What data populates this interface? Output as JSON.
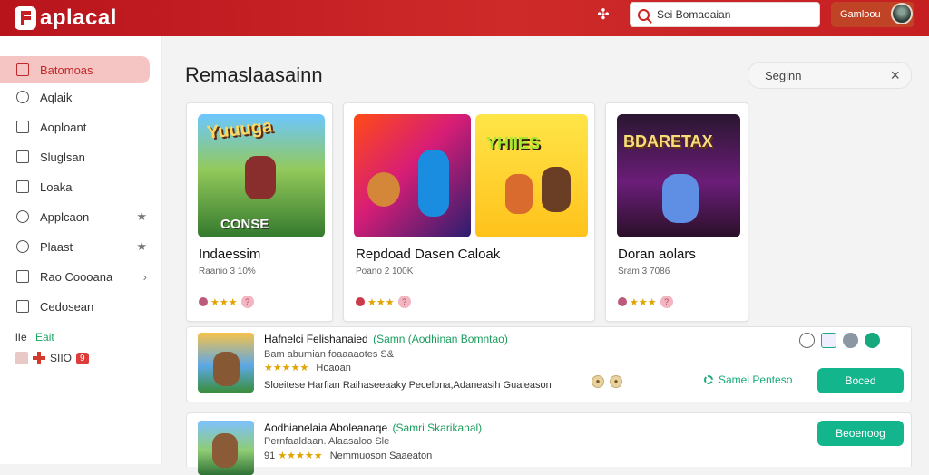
{
  "header": {
    "app_name": "aplacal",
    "search_placeholder": "Sei Bomaoaian",
    "user_label": "Gamloou"
  },
  "sidebar": {
    "items": [
      {
        "label": "Batomoas",
        "active": true
      },
      {
        "label": "Aqlaik"
      },
      {
        "label": "Aoploant"
      },
      {
        "label": "Sluglsan"
      },
      {
        "label": "Loaka"
      },
      {
        "label": "Applcaon",
        "right_icon": "★"
      },
      {
        "label": "Plaast",
        "right_icon": "★"
      },
      {
        "label": "Rao Coooana",
        "right_icon": "›"
      },
      {
        "label": "Cedosean"
      }
    ],
    "footer_a_left": "lIe",
    "footer_a_right": "Eait",
    "footer_b_text": "SIIO",
    "footer_b_badge": "9"
  },
  "main": {
    "title": "Remaslaasainn",
    "search_placeholder": "Seginn",
    "featured": [
      {
        "title": "Indaessim",
        "subtitle": "Raanio 3 10%",
        "image_text": "Yuuuga",
        "image_caption": "CONSE"
      },
      {
        "title": "Repdoad Dasen Caloak",
        "subtitle": "Poano 2 100K",
        "image_text": "YHIIES"
      },
      {
        "title": "Doran aolars",
        "subtitle": "Sram 3 7086",
        "image_text": "BDARETAX"
      }
    ],
    "list": [
      {
        "title": "Hafnelci Felishanaied",
        "tag": "(Samn (Aodhinan Bomntao)",
        "meta1": "Bam abumian foaaaaotes S&",
        "meta2": "Hoaoan",
        "desc": "Sloeitese Harfian Raihaseeaaky Pecelbna,Adaneasih Gualeason",
        "link": "Samei Penteso",
        "button": "Boced"
      },
      {
        "title": "Aodhianelaia Aboleanaqe",
        "tag": "(Samri Skarikanal)",
        "meta1": "Pernfaaldaan. Alaasaloo Sle",
        "meta2": "Nemmuoson Saaeaton",
        "meta2_prefix": "91",
        "button": "Beoenoog"
      }
    ]
  },
  "icons": {
    "logo": "brand-f-logo",
    "search": "search-icon",
    "close": "close-icon",
    "puzzle": "puzzle-icon"
  }
}
